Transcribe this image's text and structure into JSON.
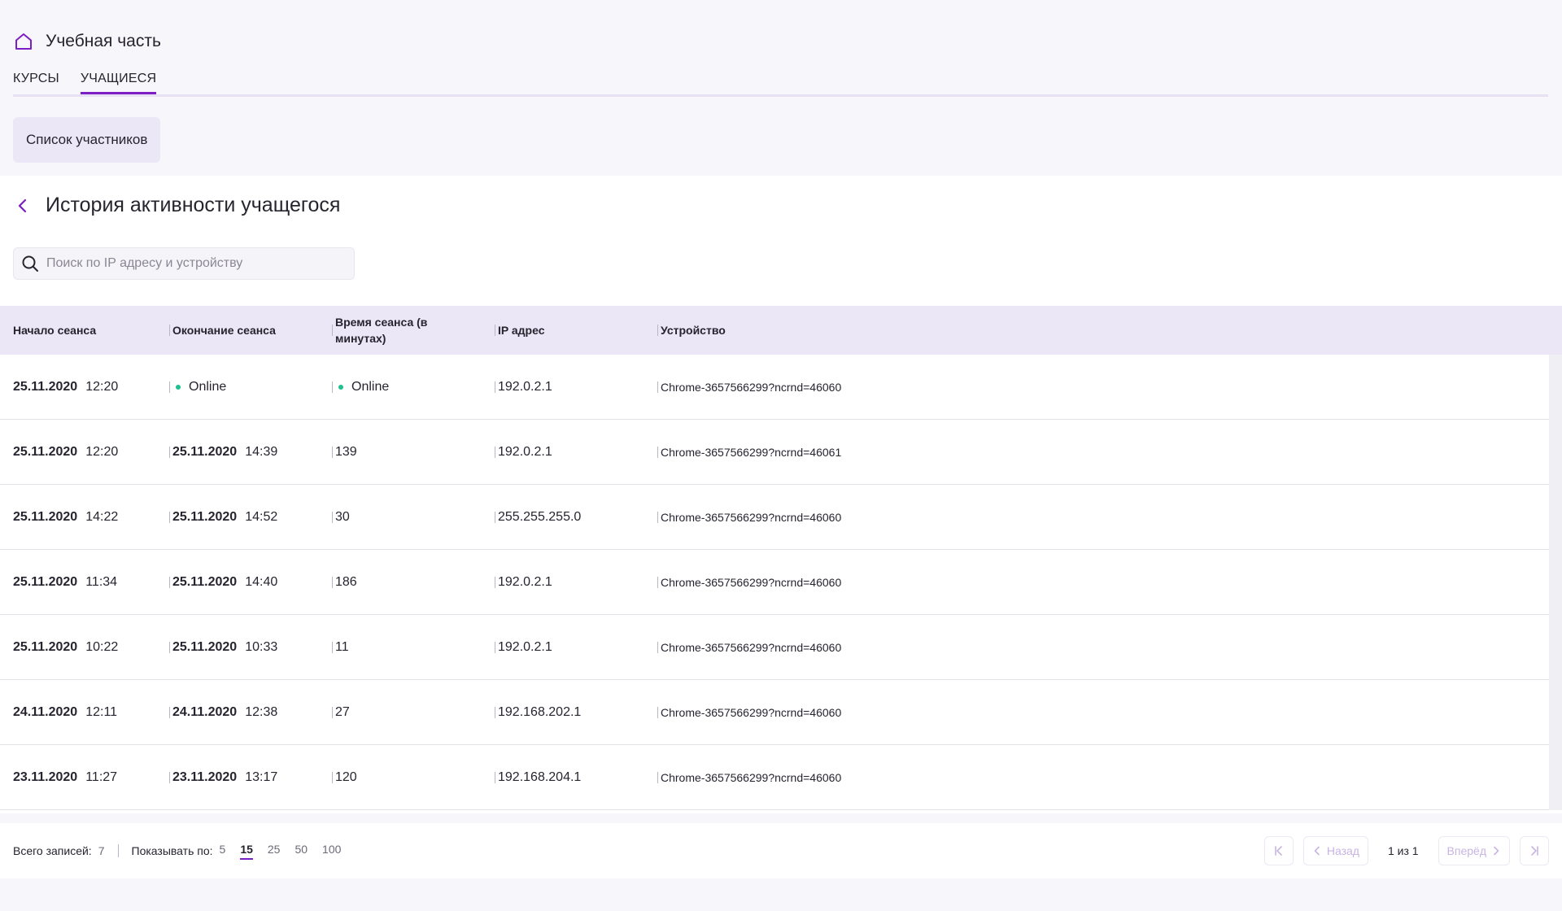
{
  "header": {
    "title": "Учебная часть",
    "icon": "home-icon",
    "accent": "#7b1fc4"
  },
  "tabs": [
    {
      "label": "КУРСЫ",
      "active": false
    },
    {
      "label": "УЧАЩИЕСЯ",
      "active": true
    }
  ],
  "subnav": {
    "label": "Список участников"
  },
  "page": {
    "title": "История активности учащегося"
  },
  "search": {
    "placeholder": "Поиск по IP адресу и устройству",
    "value": ""
  },
  "table": {
    "columns": [
      "Начало сеанса",
      "Окончание сеанса",
      "Время сеанса (в минутах)",
      "IP адрес",
      "Устройство"
    ],
    "rows": [
      {
        "start_date": "25.11.2020",
        "start_time": "12:20",
        "end_date": "",
        "end_time": "Online",
        "duration": "Online",
        "ip": "192.0.2.1",
        "device": "Chrome-3657566299?ncrnd=46060"
      },
      {
        "start_date": "25.11.2020",
        "start_time": "12:20",
        "end_date": "25.11.2020",
        "end_time": "14:39",
        "duration": "139",
        "ip": "192.0.2.1",
        "device": "Chrome-3657566299?ncrnd=46061"
      },
      {
        "start_date": "25.11.2020",
        "start_time": "14:22",
        "end_date": "25.11.2020",
        "end_time": "14:52",
        "duration": "30",
        "ip": "255.255.255.0",
        "device": "Chrome-3657566299?ncrnd=46060"
      },
      {
        "start_date": "25.11.2020",
        "start_time": "11:34",
        "end_date": "25.11.2020",
        "end_time": "14:40",
        "duration": "186",
        "ip": "192.0.2.1",
        "device": "Chrome-3657566299?ncrnd=46060"
      },
      {
        "start_date": "25.11.2020",
        "start_time": "10:22",
        "end_date": "25.11.2020",
        "end_time": "10:33",
        "duration": "11",
        "ip": "192.0.2.1",
        "device": "Chrome-3657566299?ncrnd=46060"
      },
      {
        "start_date": "24.11.2020",
        "start_time": "12:11",
        "end_date": "24.11.2020",
        "end_time": "12:38",
        "duration": "27",
        "ip": "192.168.202.1",
        "device": "Chrome-3657566299?ncrnd=46060"
      },
      {
        "start_date": "23.11.2020",
        "start_time": "11:27",
        "end_date": "23.11.2020",
        "end_time": "13:17",
        "duration": "120",
        "ip": "192.168.204.1",
        "device": "Chrome-3657566299?ncrnd=46060"
      }
    ]
  },
  "footer": {
    "total_label": "Всего записей:",
    "total_value": "7",
    "page_size_label": "Показывать по:",
    "page_sizes": [
      "5",
      "15",
      "25",
      "50",
      "100"
    ],
    "page_size_selected": "15",
    "prev_label": "Назад",
    "next_label": "Вперёд",
    "page_info": "1 из 1"
  },
  "colors": {
    "online": "#1fbf8f",
    "table_header_bg": "#ebe7f6"
  }
}
